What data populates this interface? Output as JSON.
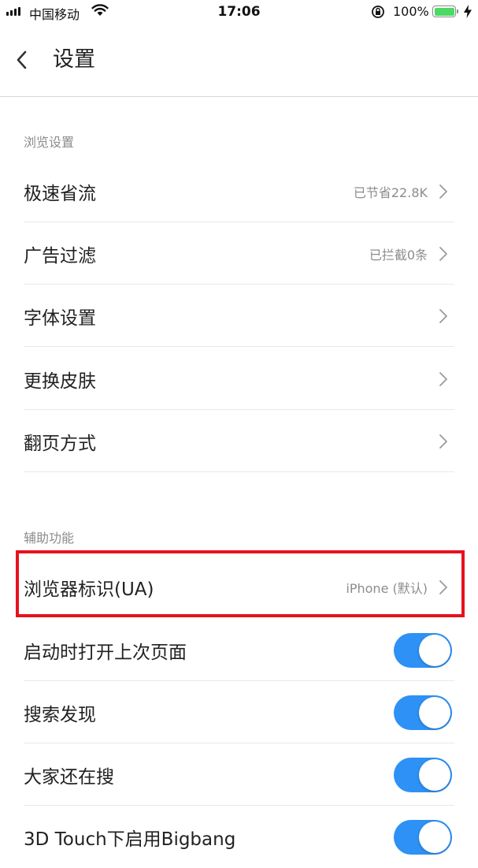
{
  "status_bar": {
    "carrier": "中国移动",
    "time": "17:06",
    "battery_percent": "100%",
    "battery_color": "#4cd964"
  },
  "nav": {
    "back_icon": "chevron-left-icon",
    "title": "设置"
  },
  "sections": {
    "browse": {
      "header": "浏览设置",
      "items": [
        {
          "label": "极速省流",
          "value": "已节省22.8K"
        },
        {
          "label": "广告过滤",
          "value": "已拦截0条"
        },
        {
          "label": "字体设置",
          "value": ""
        },
        {
          "label": "更换皮肤",
          "value": ""
        },
        {
          "label": "翻页方式",
          "value": ""
        }
      ]
    },
    "assist": {
      "header": "辅助功能",
      "items": [
        {
          "label": "浏览器标识(UA)",
          "value": "iPhone (默认)"
        },
        {
          "label": "启动时打开上次页面",
          "toggle": true
        },
        {
          "label": "搜索发现",
          "toggle": true
        },
        {
          "label": "大家还在搜",
          "toggle": true
        },
        {
          "label": "3D Touch下启用Bigbang",
          "toggle": true
        }
      ]
    }
  },
  "colors": {
    "toggle_on": "#2d91f5",
    "highlight_border": "#e8111e"
  }
}
